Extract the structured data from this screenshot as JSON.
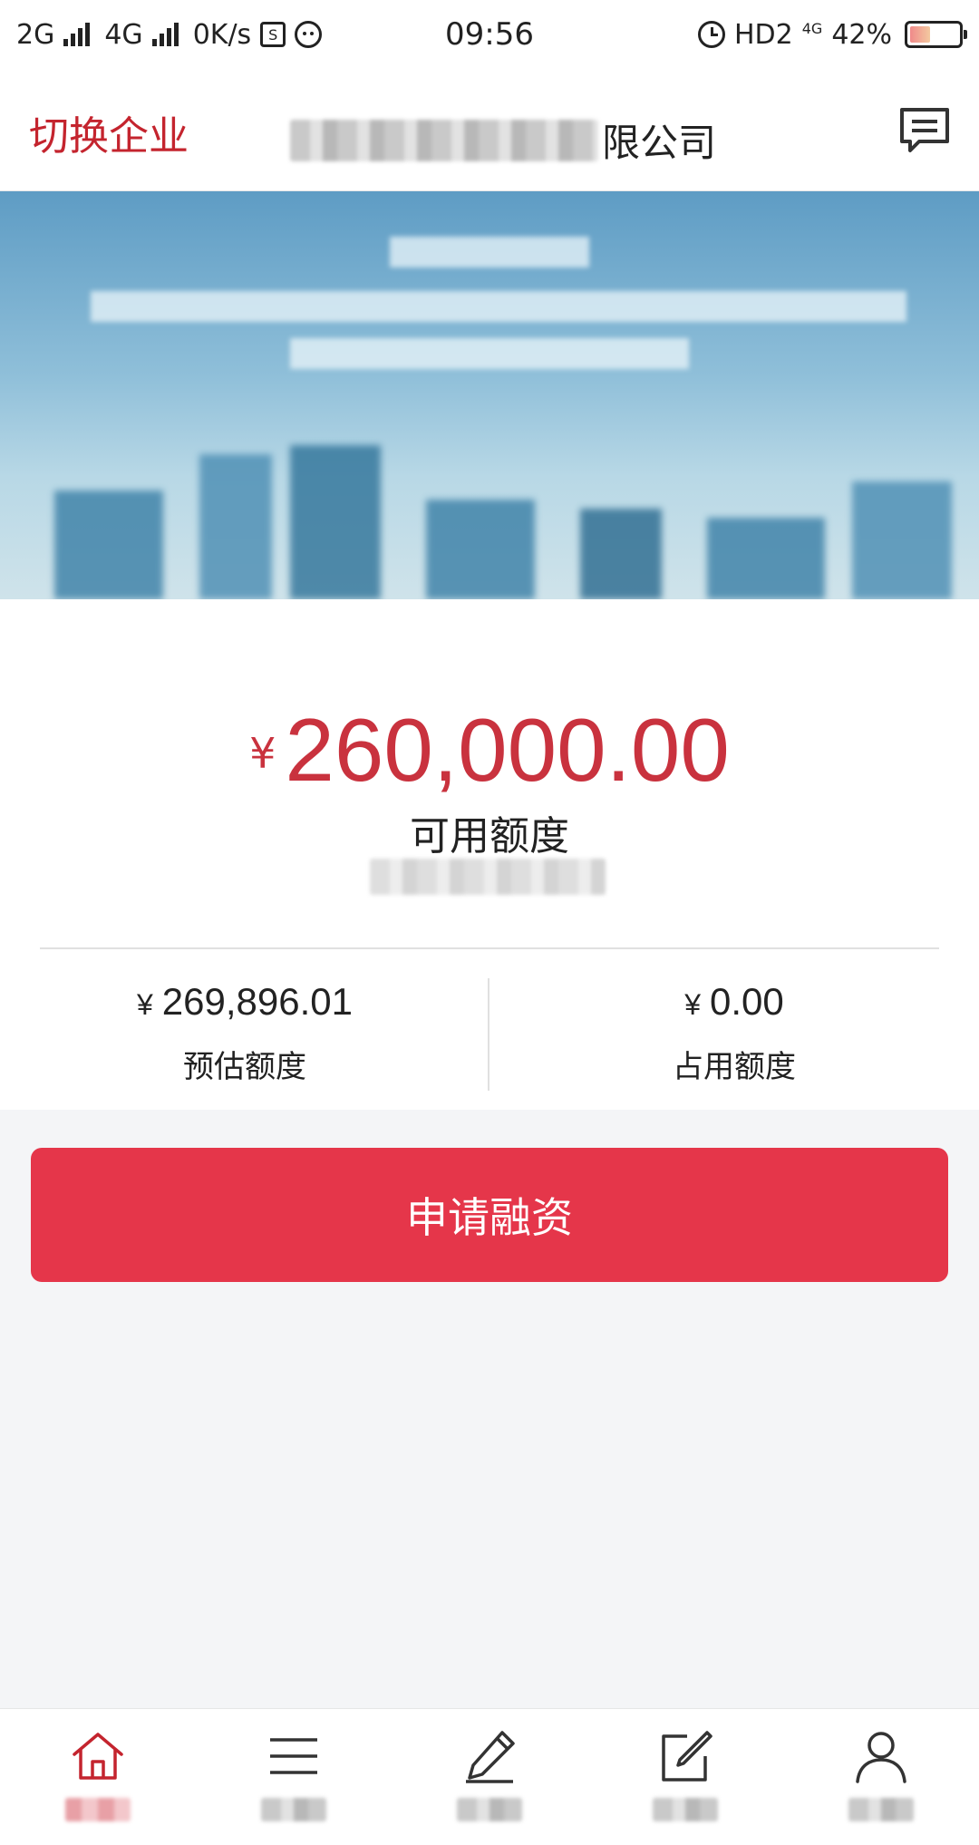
{
  "status_bar": {
    "network1": "2G",
    "network2": "4G",
    "speed": "0K/s",
    "time": "09:56",
    "hd": "HD2",
    "lte": "4G",
    "battery": "42%",
    "battery_level": 0.42
  },
  "header": {
    "switch_label": "切换企业",
    "company_suffix": "限公司"
  },
  "credit": {
    "currency": "¥",
    "available_amount": "260,000.00",
    "available_label": "可用额度",
    "estimated_amount": "269,896.01",
    "estimated_label": "预估额度",
    "occupied_amount": "0.00",
    "occupied_label": "占用额度"
  },
  "actions": {
    "apply_label": "申请融资"
  },
  "colors": {
    "accent": "#c4242e",
    "button": "#e5364a",
    "amount": "#c9323e"
  },
  "nav": {
    "items": [
      {
        "icon": "home-icon"
      },
      {
        "icon": "menu-icon"
      },
      {
        "icon": "pencil-icon"
      },
      {
        "icon": "edit-square-icon"
      },
      {
        "icon": "user-icon"
      }
    ]
  }
}
